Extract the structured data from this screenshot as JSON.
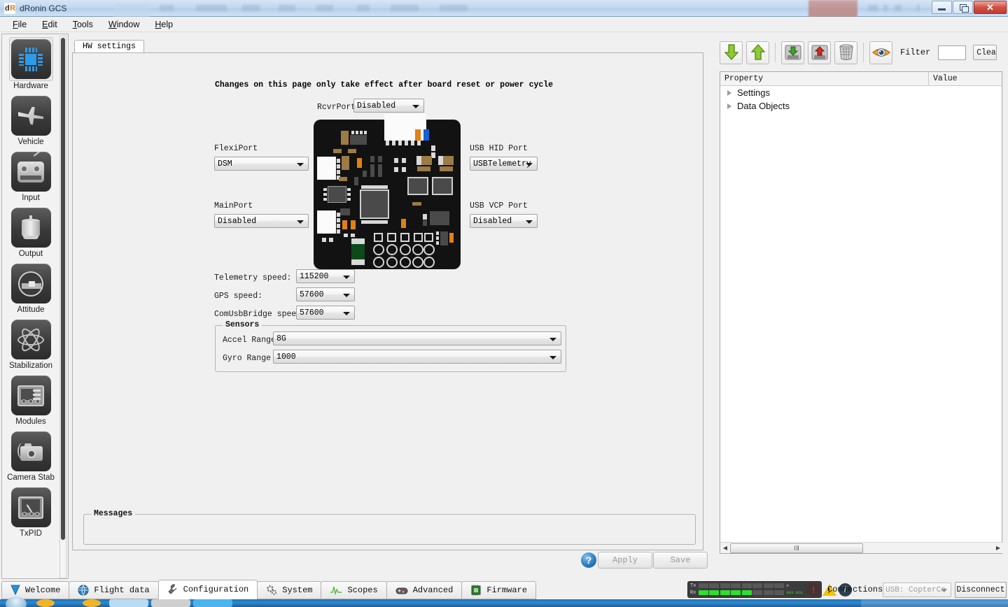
{
  "window": {
    "title": "dRonin GCS",
    "logo_d": "d",
    "logo_r": "R",
    "controls": {
      "minimize": "minimize-icon",
      "restore": "restore-icon",
      "close": "✕"
    }
  },
  "menubar": {
    "items": [
      {
        "label": "File",
        "mnemonic": "F"
      },
      {
        "label": "Edit",
        "mnemonic": "E"
      },
      {
        "label": "Tools",
        "mnemonic": "T"
      },
      {
        "label": "Window",
        "mnemonic": "W"
      },
      {
        "label": "Help",
        "mnemonic": "H"
      }
    ]
  },
  "sidebar": {
    "items": [
      {
        "label": "Hardware",
        "icon": "chip-icon",
        "selected": true
      },
      {
        "label": "Vehicle",
        "icon": "aircraft-icon",
        "selected": false
      },
      {
        "label": "Input",
        "icon": "transmitter-icon",
        "selected": false
      },
      {
        "label": "Output",
        "icon": "motor-icon",
        "selected": false
      },
      {
        "label": "Attitude",
        "icon": "level-bubble-icon",
        "selected": false
      },
      {
        "label": "Stabilization",
        "icon": "gyro-orbit-icon",
        "selected": false
      },
      {
        "label": "Modules",
        "icon": "waveform-panel-icon",
        "selected": false
      },
      {
        "label": "Camera Stab",
        "icon": "camera-icon",
        "selected": false
      },
      {
        "label": "TxPID",
        "icon": "gauge-icon",
        "selected": false
      }
    ]
  },
  "main": {
    "tab_label": "HW settings",
    "notice": "Changes on this page only take effect after board reset or power cycle",
    "fields": {
      "rcvr_port": {
        "label": "RcvrPort",
        "value": "Disabled"
      },
      "flexi_port": {
        "label": "FlexiPort",
        "value": "DSM"
      },
      "main_port": {
        "label": "MainPort",
        "value": "Disabled"
      },
      "usb_hid_port": {
        "label": "USB HID Port",
        "value": "USBTelemetry"
      },
      "usb_vcp_port": {
        "label": "USB VCP Port",
        "value": "Disabled"
      },
      "telemetry_speed": {
        "label": "Telemetry speed:",
        "value": "115200"
      },
      "gps_speed": {
        "label": "GPS speed:",
        "value": "57600"
      },
      "comusbbridge_speed": {
        "label": "ComUsbBridge speed:",
        "value": "57600"
      }
    },
    "sensors": {
      "title": "Sensors",
      "accel_range": {
        "label": "Accel Range",
        "value": "8G"
      },
      "gyro_range": {
        "label": "Gyro Range",
        "value": "1000"
      }
    },
    "messages": {
      "title": "Messages",
      "body": ""
    },
    "actions": {
      "help": "?",
      "apply": "Apply",
      "save": "Save"
    }
  },
  "right_panel": {
    "toolbar": {
      "buttons": [
        {
          "name": "load-from-board",
          "icon": "arrow-down-green-icon"
        },
        {
          "name": "save-to-board",
          "icon": "arrow-up-green-icon"
        },
        {
          "name": "load-from-file",
          "icon": "disk-download-icon"
        },
        {
          "name": "save-to-file",
          "icon": "disk-upload-icon"
        },
        {
          "name": "erase-settings",
          "icon": "trash-icon"
        },
        {
          "name": "toggle-visibility",
          "icon": "eye-icon"
        }
      ],
      "filter_label": "Filter",
      "filter_value": "",
      "filter_placeholder": "",
      "clear_label": "Clear"
    },
    "tree": {
      "columns": [
        "Property",
        "Value"
      ],
      "rows": [
        {
          "label": "Settings",
          "value": "",
          "expanded": false
        },
        {
          "label": "Data Objects",
          "value": "",
          "expanded": false
        }
      ]
    }
  },
  "bottom_tabs": [
    {
      "label": "Welcome",
      "icon": "welcome-icon",
      "active": false
    },
    {
      "label": "Flight data",
      "icon": "globe-icon",
      "active": false
    },
    {
      "label": "Configuration",
      "icon": "wrench-icon",
      "active": true
    },
    {
      "label": "System",
      "icon": "gears-icon",
      "active": false
    },
    {
      "label": "Scopes",
      "icon": "waveform-icon",
      "active": false
    },
    {
      "label": "Advanced",
      "icon": "gamepad-icon",
      "active": false
    },
    {
      "label": "Firmware",
      "icon": "chip-green-icon",
      "active": false
    }
  ],
  "statusbar": {
    "telemetry": {
      "tx_label": "Tx",
      "rx_label": "Rx",
      "tx_segments": [
        false,
        false,
        false,
        false,
        false,
        false,
        false,
        false
      ],
      "rx_segments": [
        true,
        true,
        true,
        true,
        true,
        false,
        false,
        false
      ],
      "tx_rate": "0",
      "rx_rate": "803.828",
      "alerts": {
        "error": "!",
        "warning": "!",
        "info": "i"
      }
    },
    "connections_label": "Connections:",
    "connection_value": "USB: CopterCo",
    "disconnect_label": "Disconnect"
  },
  "colors": {
    "accent_blue": "#2f9ae8",
    "green_arrow": "#7dbf2e",
    "red_arrow": "#cc2b22",
    "pcb_dark": "#121212",
    "titlebar": "#c2d8ef",
    "warning_yellow": "#f2c200",
    "rx_green": "#2ee02e"
  }
}
